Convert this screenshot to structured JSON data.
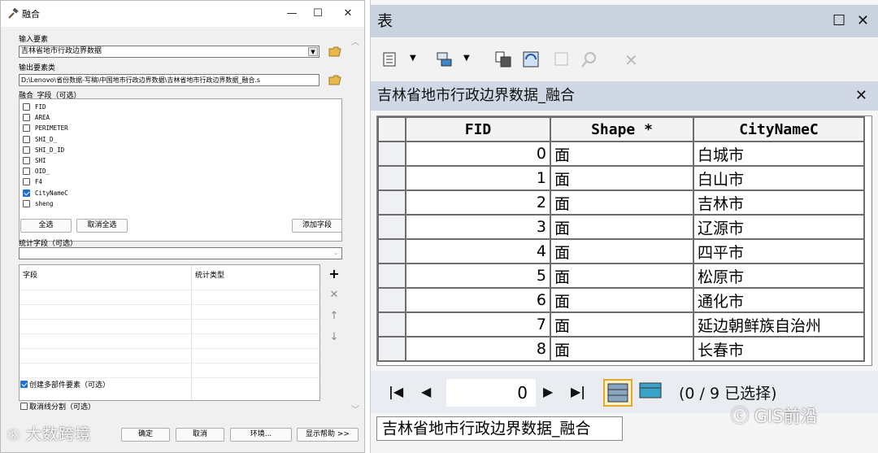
{
  "dialog": {
    "title": "融合",
    "input_label": "输入要素",
    "input_value": "吉林省地市行政边界数据",
    "output_label": "输出要素类",
    "output_value": "D:\\Lenovo\\省份数据-写稿\\中国地市行政边界数据\\吉林省地市行政边界数据_融合.s",
    "dissolve_label": "融合_字段（可选）",
    "fields": [
      {
        "name": "FID",
        "checked": false
      },
      {
        "name": "AREA",
        "checked": false
      },
      {
        "name": "PERIMETER",
        "checked": false
      },
      {
        "name": "SHI_D_",
        "checked": false
      },
      {
        "name": "SHI_D_ID",
        "checked": false
      },
      {
        "name": "SHI",
        "checked": false
      },
      {
        "name": "OID_",
        "checked": false
      },
      {
        "name": "F4",
        "checked": false
      },
      {
        "name": "CityNameC",
        "checked": true
      },
      {
        "name": "sheng",
        "checked": false
      }
    ],
    "select_all": "全选",
    "clear_all": "取消全选",
    "add_field": "添加字段",
    "stats_label": "统计字段（可选）",
    "stats_col_field": "字段",
    "stats_col_type": "统计类型",
    "multipart_label": "创建多部件要素（可选）",
    "unsplit_label": "取消线分割（可选）",
    "ok": "确定",
    "cancel": "取消",
    "env": "环境...",
    "help": "显示帮助 >>"
  },
  "table_window": {
    "title": "表",
    "tab_title": "吉林省地市行政边界数据_融合",
    "columns": [
      "FID",
      "Shape *",
      "CityNameC"
    ],
    "rows": [
      {
        "fid": "0",
        "shape": "面",
        "city": "白城市"
      },
      {
        "fid": "1",
        "shape": "面",
        "city": "白山市"
      },
      {
        "fid": "2",
        "shape": "面",
        "city": "吉林市"
      },
      {
        "fid": "3",
        "shape": "面",
        "city": "辽源市"
      },
      {
        "fid": "4",
        "shape": "面",
        "city": "四平市"
      },
      {
        "fid": "5",
        "shape": "面",
        "city": "松原市"
      },
      {
        "fid": "6",
        "shape": "面",
        "city": "通化市"
      },
      {
        "fid": "7",
        "shape": "面",
        "city": "延边朝鲜族自治州"
      },
      {
        "fid": "8",
        "shape": "面",
        "city": "长春市"
      }
    ],
    "current_record": "0",
    "selection_text": "(0 / 9 已选择)",
    "bottom_tab": "吉林省地市行政边界数据_融合"
  },
  "watermarks": {
    "left": "大数跨境",
    "right": "GIS前沿"
  }
}
